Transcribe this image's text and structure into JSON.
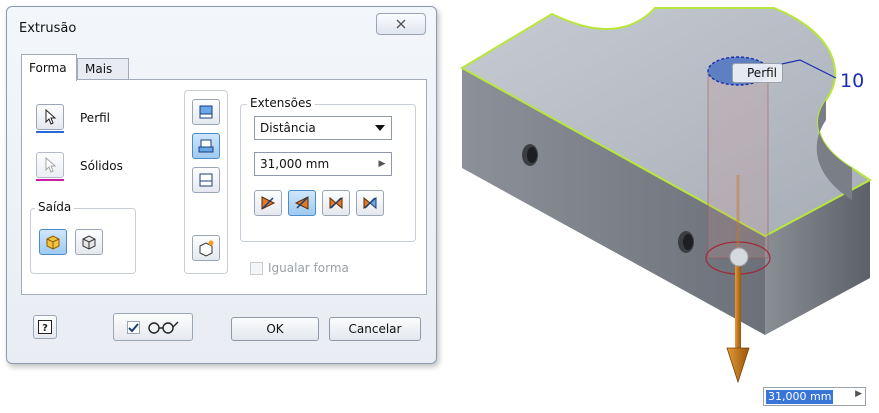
{
  "dialog": {
    "title": "Extrusão",
    "tabs": [
      {
        "label": "Forma",
        "active": true
      },
      {
        "label": "Mais",
        "active": false
      }
    ],
    "profile_label": "Perfil",
    "solids_label": "Sólidos",
    "output": {
      "title": "Saída"
    },
    "extents": {
      "title": "Extensões",
      "type_value": "Distância",
      "distance_value": "31,000 mm"
    },
    "match_shape_label": "Igualar forma",
    "preview_checked": true,
    "buttons": {
      "ok": "OK",
      "cancel": "Cancelar"
    }
  },
  "viewport": {
    "profile_tag": "Perfil",
    "balloon_number": "10",
    "distance_readout": "31,000 mm"
  },
  "colors": {
    "accent_blue": "#3875d7",
    "selection_green": "#b9e63a",
    "arrow_orange": "#c8740f",
    "profile_blue": "#1a2fb0"
  }
}
